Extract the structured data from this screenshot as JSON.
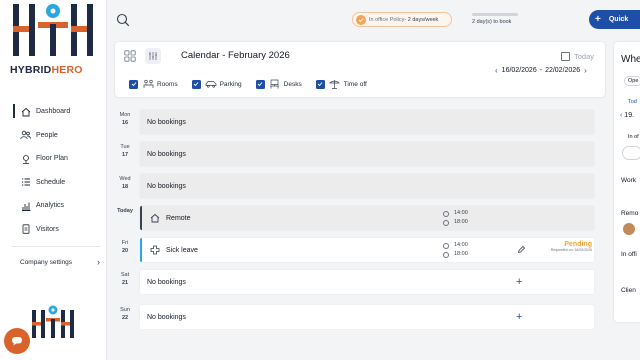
{
  "brand": {
    "name_part1": "HYBRID",
    "name_part2": "HERO"
  },
  "colors": {
    "brand_navy": "#1f2a44",
    "brand_orange": "#d9632b",
    "accent_blue": "#1e4fa8",
    "pending": "#f2a33a",
    "sick_leave": "#29a8e0"
  },
  "sidebar": {
    "items": [
      {
        "label": "Dashboard",
        "icon": "home-icon",
        "active": true
      },
      {
        "label": "People",
        "icon": "people-icon",
        "active": false
      },
      {
        "label": "Floor Plan",
        "icon": "floor-plan-icon",
        "active": false
      },
      {
        "label": "Schedule",
        "icon": "schedule-icon",
        "active": false
      },
      {
        "label": "Analytics",
        "icon": "analytics-icon",
        "active": false
      },
      {
        "label": "Visitors",
        "icon": "visitors-icon",
        "active": false
      }
    ],
    "company_settings": "Company settings"
  },
  "topbar": {
    "policy_label": "In office Policy",
    "policy_value": "- 2 days/week",
    "days_to_book": "2 day(s) to book",
    "quick_label": "Quick"
  },
  "calendar": {
    "title": "Calendar - February 2026",
    "today_label": "Today",
    "range_start": "16/02/2026",
    "range_sep": "-",
    "range_end": "22/02/2026",
    "filters": [
      {
        "label": "Rooms",
        "icon": "rooms-icon",
        "checked": true
      },
      {
        "label": "Parking",
        "icon": "car-icon",
        "checked": true
      },
      {
        "label": "Desks",
        "icon": "desk-icon",
        "checked": true
      },
      {
        "label": "Time off",
        "icon": "time-off-icon",
        "checked": true
      }
    ]
  },
  "days": [
    {
      "weekday": "Mon",
      "date": "16",
      "text": "No bookings",
      "past": true
    },
    {
      "weekday": "Tue",
      "date": "17",
      "text": "No bookings",
      "past": true
    },
    {
      "weekday": "Wed",
      "date": "18",
      "text": "No bookings",
      "past": true
    },
    {
      "weekday": "Today",
      "date": "",
      "text": "Remote",
      "start": "14:00",
      "end": "18:00",
      "kind": "remote"
    },
    {
      "weekday": "Fri",
      "date": "20",
      "text": "Sick leave",
      "start": "14:00",
      "end": "18:00",
      "kind": "sick",
      "status": "Pending",
      "status_note": "Requested on: 16/02/2026"
    },
    {
      "weekday": "Sat",
      "date": "21",
      "text": "No bookings",
      "past": false
    },
    {
      "weekday": "Sun",
      "date": "22",
      "text": "No bookings",
      "past": false
    }
  ],
  "right_panel": {
    "title": "Whe",
    "tab": "Ope",
    "today": "Tod",
    "date": "19.",
    "in_office_short": "In of",
    "work": "Work",
    "remote": "Remo",
    "in_office": "In offi",
    "client": "Clien"
  }
}
